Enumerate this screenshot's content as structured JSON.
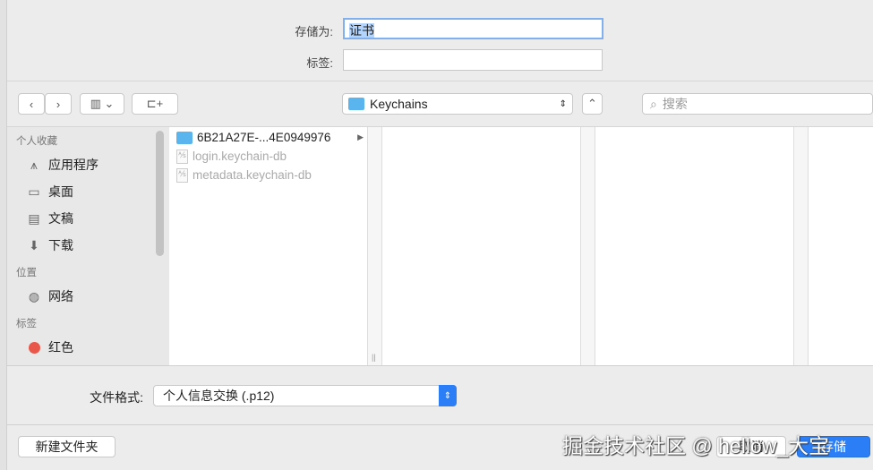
{
  "save_as": {
    "label": "存储为:",
    "value": "证书"
  },
  "tags": {
    "label": "标签:",
    "value": ""
  },
  "toolbar": {
    "location": "Keychains",
    "search_placeholder": "搜索"
  },
  "sidebar": {
    "sections": [
      {
        "title": "个人收藏",
        "items": [
          {
            "label": "应用程序",
            "icon": "apps-icon"
          },
          {
            "label": "桌面",
            "icon": "desktop-icon"
          },
          {
            "label": "文稿",
            "icon": "documents-icon"
          },
          {
            "label": "下载",
            "icon": "downloads-icon"
          }
        ]
      },
      {
        "title": "位置",
        "items": [
          {
            "label": "网络",
            "icon": "network-icon"
          }
        ]
      },
      {
        "title": "标签",
        "items": [
          {
            "label": "红色",
            "icon": "red-tag-icon",
            "color": "#e9574a"
          }
        ]
      }
    ]
  },
  "files": [
    {
      "name": "6B21A27E-...4E0949976",
      "type": "folder",
      "enabled": true
    },
    {
      "name": "login.keychain-db",
      "type": "file",
      "enabled": false
    },
    {
      "name": "metadata.keychain-db",
      "type": "file",
      "enabled": false
    }
  ],
  "format": {
    "label": "文件格式:",
    "value": "个人信息交换 (.p12)"
  },
  "buttons": {
    "new_folder": "新建文件夹",
    "cancel": "取消",
    "save": "存储"
  },
  "watermark": "掘金技术社区 @ hellow_大宝",
  "colors": {
    "accent": "#2b7ef6",
    "folder": "#5ab5ee"
  }
}
